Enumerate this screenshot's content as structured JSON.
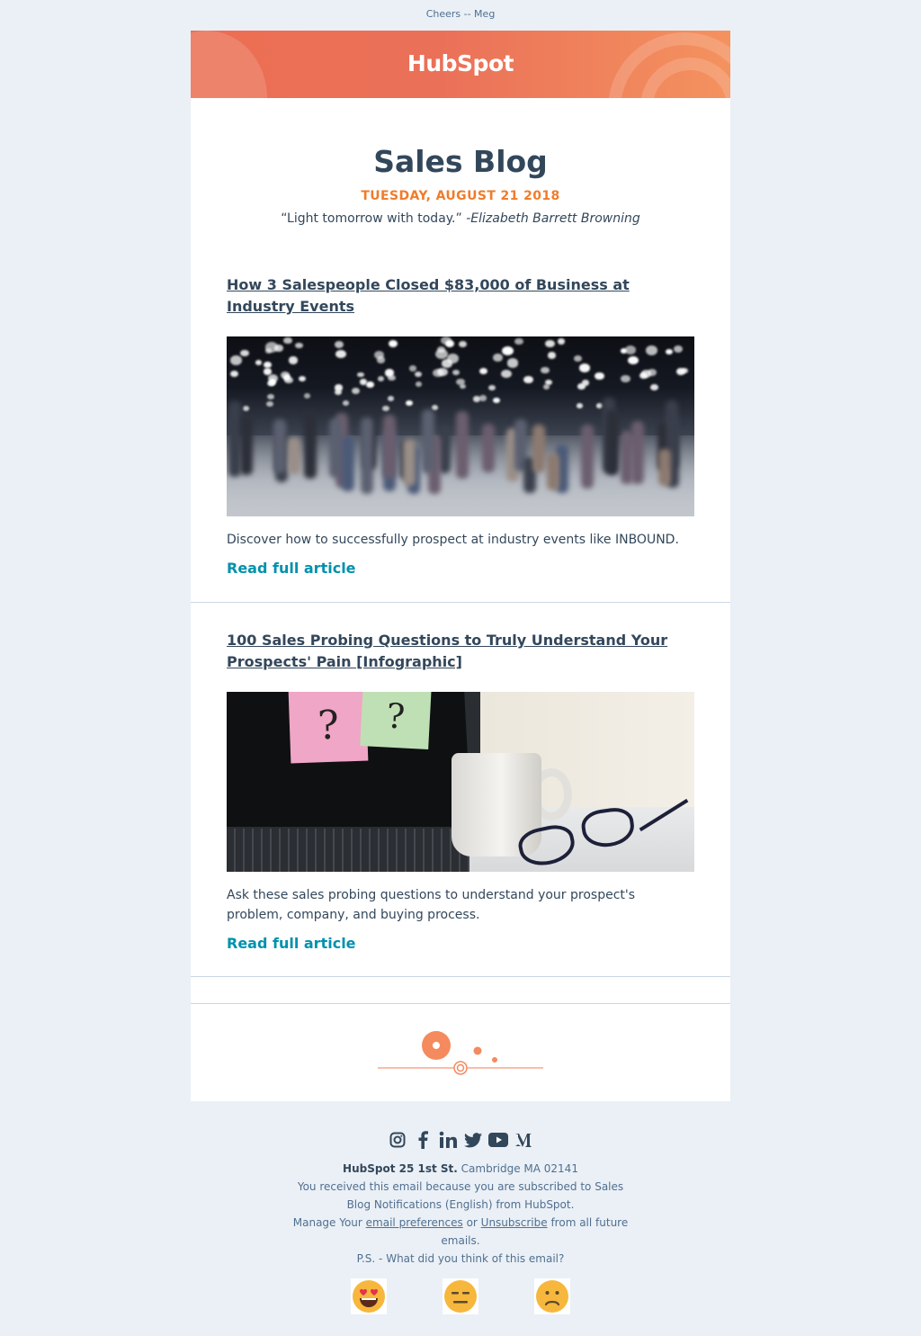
{
  "preheader": "Cheers -- Meg",
  "brand": {
    "logo_text": "HubSpot",
    "accent": "#f07c2b",
    "banner_start": "#ec6f53",
    "banner_end": "#f4925f",
    "link_color": "#0091ae"
  },
  "hero": {
    "title": "Sales Blog",
    "date": "TUESDAY, AUGUST 21 2018",
    "quote_text": "“Light tomorrow with today.”",
    "quote_author": "-Elizabeth Barrett Browning"
  },
  "posts": [
    {
      "title": "How 3 Salespeople Closed $83,000 of Business at Industry Events",
      "image": "trade-show-crowd-image",
      "summary": "Discover how to successfully prospect at industry events like INBOUND.",
      "cta": "Read full article"
    },
    {
      "title": "100 Sales Probing Questions to Truly Understand Your Prospects' Pain [Infographic]",
      "image": "laptop-sticky-notes-mug-image",
      "image_notes": [
        "?",
        "?"
      ],
      "summary": "Ask these sales probing questions to understand your prospect's problem, company, and buying process.",
      "cta": "Read full article"
    }
  ],
  "footer": {
    "social_icons": [
      "instagram-icon",
      "facebook-icon",
      "linkedin-icon",
      "twitter-icon",
      "youtube-icon",
      "medium-icon"
    ],
    "company_bold": "HubSpot 25 1st St.",
    "company_rest": " Cambridge MA 02141",
    "subscribed_text": "You received this email because you are subscribed to Sales Blog Notifications (English) from HubSpot.",
    "manage_prefix": "Manage Your ",
    "preferences_link": "email preferences",
    "manage_or": " or ",
    "unsubscribe_link": "Unsubscribe",
    "manage_suffix": " from all future emails.",
    "ps_text": "P.S. - What did you think of this email?",
    "feedback_icons": [
      "heart-eyes-icon",
      "expressionless-face-icon",
      "frowning-face-icon"
    ]
  }
}
